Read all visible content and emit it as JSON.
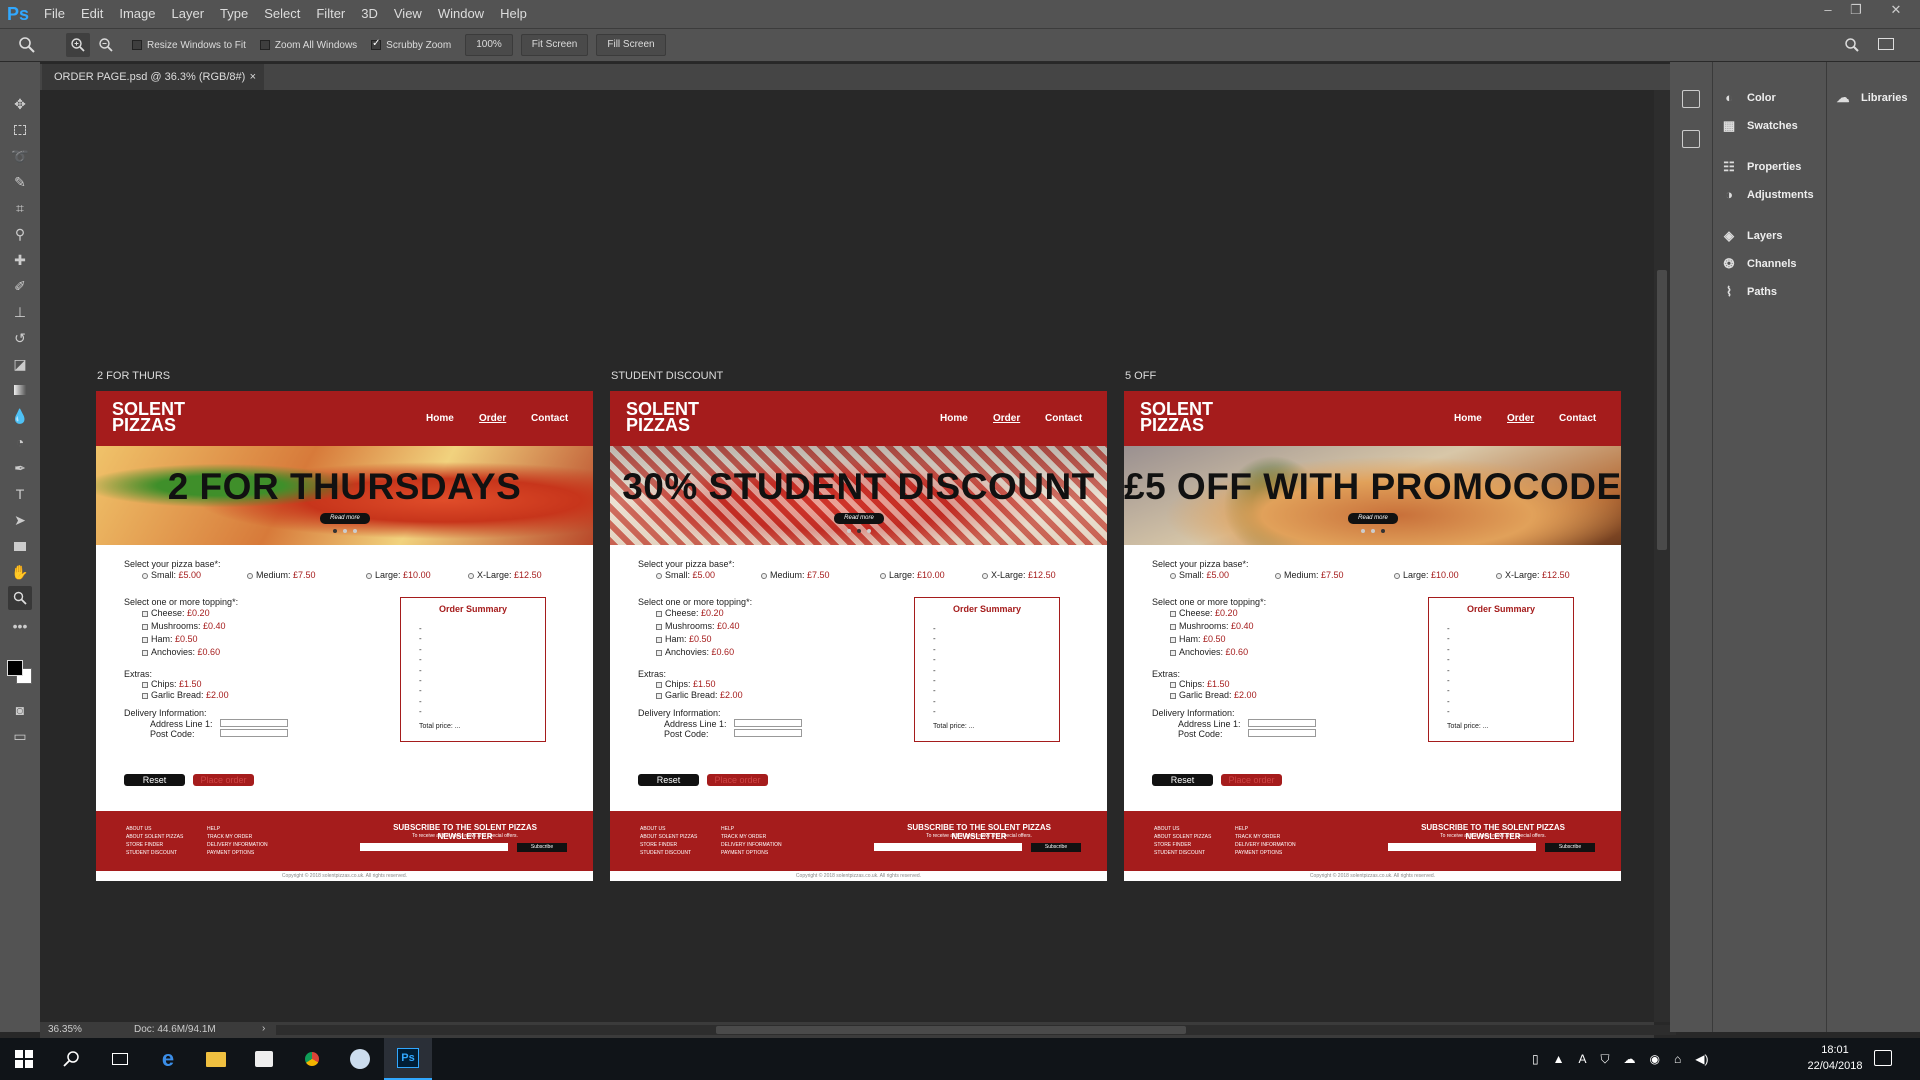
{
  "app": {
    "logo": "Ps"
  },
  "menu": [
    "File",
    "Edit",
    "Image",
    "Layer",
    "Type",
    "Select",
    "Filter",
    "3D",
    "View",
    "Window",
    "Help"
  ],
  "window_controls": {
    "minimize": "–",
    "restore": "❐",
    "close": "✕"
  },
  "options": {
    "resize_windows": "Resize Windows to Fit",
    "zoom_all": "Zoom All Windows",
    "scrubby_zoom": "Scrubby Zoom",
    "zoom_value": "100%",
    "fit_screen": "Fit Screen",
    "fill_screen": "Fill Screen"
  },
  "document": {
    "tab_title": "ORDER PAGE.psd @ 36.3% (RGB/8#)",
    "close": "×"
  },
  "status": {
    "zoom": "36.35%",
    "doc": "Doc: 44.6M/94.1M",
    "arrow": "›"
  },
  "panels": {
    "color": "Color",
    "swatches": "Swatches",
    "properties": "Properties",
    "adjustments": "Adjustments",
    "layers": "Layers",
    "channels": "Channels",
    "paths": "Paths",
    "libraries": "Libraries"
  },
  "site": {
    "logo_line1": "SOLENT",
    "logo_line2": "PIZZAS",
    "nav_home": "Home",
    "nav_order": "Order",
    "nav_contact": "Contact",
    "read_more": "Read more",
    "base_label": "Select your pizza base*:",
    "small": "Small:",
    "small_price": "£5.00",
    "medium": "Medium:",
    "medium_price": "£7.50",
    "large": "Large:",
    "large_price": "£10.00",
    "xlarge": "X-Large:",
    "xlarge_price": "£12.50",
    "topping_label": "Select one or more topping*:",
    "cheese": "Cheese:",
    "cheese_price": "£0.20",
    "mushrooms": "Mushrooms:",
    "mushrooms_price": "£0.40",
    "ham": "Ham:",
    "ham_price": "£0.50",
    "anchovies": "Anchovies:",
    "anchovies_price": "£0.60",
    "extras_label": "Extras:",
    "chips": "Chips:",
    "chips_price": "£1.50",
    "garlic": "Garlic Bread:",
    "garlic_price": "£2.00",
    "delivery_label": "Delivery Information:",
    "address": "Address Line 1:",
    "postcode": "Post Code:",
    "summary_title": "Order Summary",
    "summary_lines": "-\n-\n-\n-\n-\n-\n-\n-\n-",
    "total": "Total price: ...",
    "reset": "Reset",
    "place_order": "Place order",
    "footer_col1": "ABOUT US\nABOUT SOLENT PIZZAS\nSTORE FINDER\nSTUDENT DISCOUNT",
    "footer_col2": "HELP\nTRACK MY ORDER\nDELIVERY INFORMATION\nPAYMENT OPTIONS",
    "subscribe_title": "SUBSCRIBE TO THE SOLENT PIZZAS NEWSLETTER",
    "subscribe_text": "To receive all the latest news and special offers.",
    "subscribe_btn": "Subscribe",
    "copyright": "Copyright © 2018 solentpizzas.co.uk. All rights reserved."
  },
  "artboards": [
    {
      "label": "2 FOR THURS",
      "hero": "2 FOR THURSDAYS"
    },
    {
      "label": "STUDENT DISCOUNT",
      "hero": "30% STUDENT DISCOUNT"
    },
    {
      "label": "5 OFF",
      "hero": "£5 OFF WITH PROMOCODE"
    }
  ],
  "clock": {
    "time": "18:01",
    "date": "22/04/2018"
  },
  "colors": {
    "brand_red": "#a51c1c",
    "ps_blue": "#31a8ff",
    "workspace": "#282828"
  }
}
